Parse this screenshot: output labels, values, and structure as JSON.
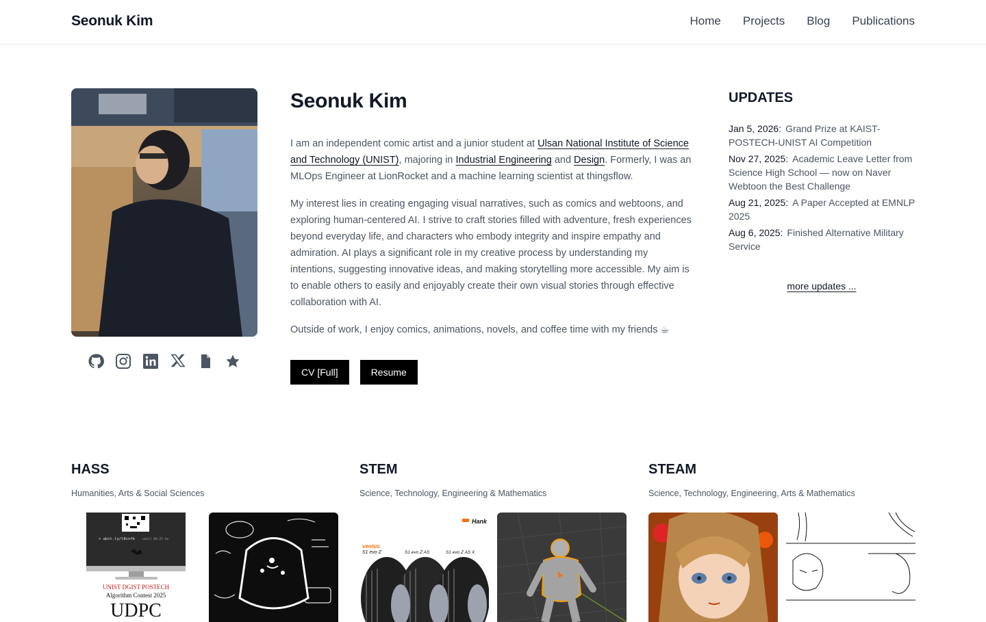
{
  "header": {
    "brand": "Seonuk Kim",
    "nav": [
      "Home",
      "Projects",
      "Blog",
      "Publications"
    ]
  },
  "profile": {
    "name": "Seonuk Kim",
    "bio1_a": "I am an independent comic artist and a junior student at ",
    "bio1_link1": "Ulsan National Institute of Science and Technology (UNIST)",
    "bio1_b": ", majoring in ",
    "bio1_link2": "Industrial Engineering",
    "bio1_c": " and ",
    "bio1_link3": "Design",
    "bio1_d": ". Formerly, I was an MLOps Engineer at LionRocket and a machine learning scientist at thingsflow.",
    "bio2": "My interest lies in creating engaging visual narratives, such as comics and webtoons, and exploring human-centered AI. I strive to craft stories filled with adventure, fresh experiences beyond everyday life, and characters who embody integrity and inspire empathy and admiration. AI plays a significant role in my creative process by understanding my intentions, suggesting innovative ideas, and making storytelling more accessible. My aim is to enable others to easily and enjoyably create their own visual stories through effective collaboration with AI.",
    "bio3": "Outside of work, I enjoy comics, animations, novels, and coffee time with my friends ☕",
    "buttons": [
      "CV [Full]",
      "Resume"
    ],
    "social_icons": [
      "github-icon",
      "instagram-icon",
      "linkedin-icon",
      "x-icon",
      "document-icon",
      "star-icon"
    ]
  },
  "updates": {
    "title": "UPDATES",
    "items": [
      {
        "date": "Jan 5, 2026:",
        "text": "Grand Prize at KAIST-POSTECH-UNIST AI Competition"
      },
      {
        "date": "Nov 27, 2025:",
        "text": "Academic Leave Letter from Science High School — now on Naver Webtoon the Best Challenge"
      },
      {
        "date": "Aug 21, 2025:",
        "text": "A Paper Accepted at EMNLP 2025"
      },
      {
        "date": "Aug 6, 2025:",
        "text": "Finished Alternative Military Service"
      }
    ],
    "more": "more updates ..."
  },
  "categories": [
    {
      "title": "HASS",
      "subtitle": "Humanities, Arts & Social Sciences",
      "thumb_texts": [
        "> abit.ly/l8cnfb",
        "until 09.25 tm",
        "UNIST DGIST POSTECH",
        "Algorithm Contest 2025",
        "UDPC"
      ]
    },
    {
      "title": "STEM",
      "subtitle": "Science, Technology, Engineering & Mathematics",
      "thumb_texts": [
        "Hank",
        "ventus",
        "S1 evo Z",
        "S1 evo Z AS",
        "S1 evo Z AS X"
      ]
    },
    {
      "title": "STEAM",
      "subtitle": "Science, Technology, Engineering, Arts & Mathematics",
      "thumb_texts": []
    }
  ],
  "colors": {
    "accent": "#000000",
    "text": "#111827",
    "muted": "#4b5563",
    "border": "#e5e7eb"
  }
}
